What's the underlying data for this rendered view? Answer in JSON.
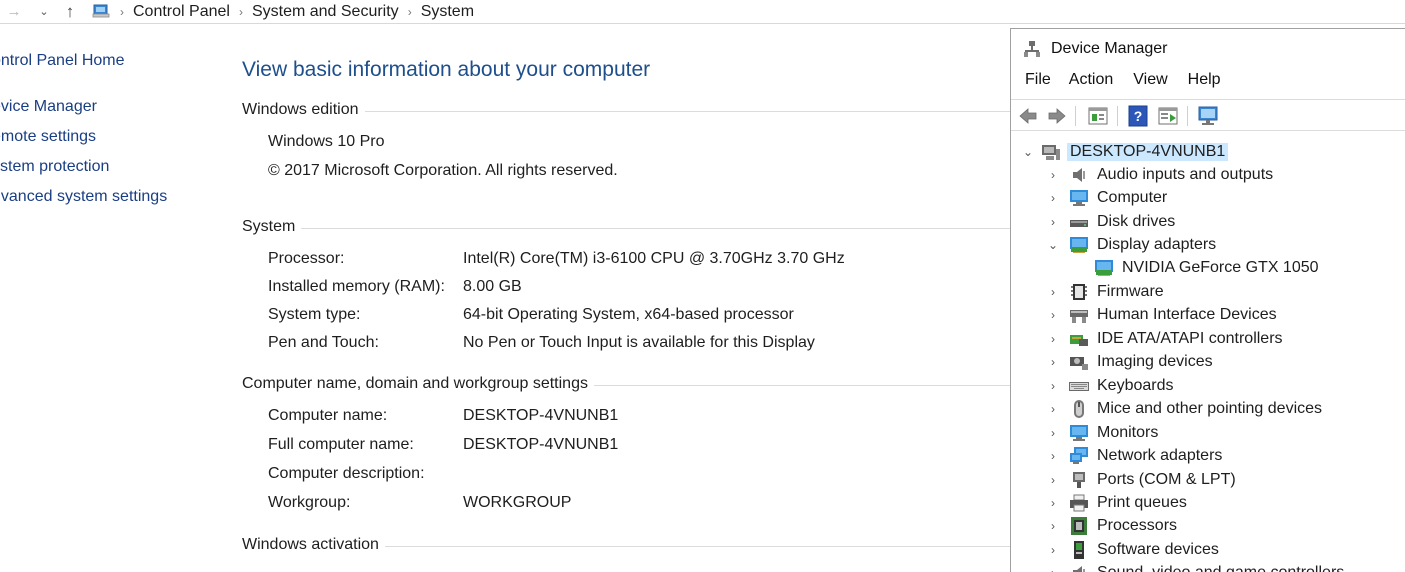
{
  "breadcrumb": {
    "items": [
      "Control Panel",
      "System and Security",
      "System"
    ],
    "separator": "›"
  },
  "left_nav": {
    "home": "ontrol Panel Home",
    "items": [
      "evice Manager",
      "emote settings",
      "ystem protection",
      "dvanced system settings"
    ]
  },
  "main": {
    "title": "View basic information about your computer",
    "edition": {
      "heading": "Windows edition",
      "name": "Windows 10 Pro",
      "copyright": "© 2017 Microsoft Corporation. All rights reserved."
    },
    "system": {
      "heading": "System",
      "rows": [
        {
          "k": "Processor:",
          "v": "Intel(R) Core(TM) i3-6100 CPU @ 3.70GHz   3.70 GHz"
        },
        {
          "k": "Installed memory (RAM):",
          "v": "8.00 GB"
        },
        {
          "k": "System type:",
          "v": "64-bit Operating System, x64-based processor"
        },
        {
          "k": "Pen and Touch:",
          "v": "No Pen or Touch Input is available for this Display"
        }
      ]
    },
    "computer": {
      "heading": "Computer name, domain and workgroup settings",
      "rows": [
        {
          "k": "Computer name:",
          "v": "DESKTOP-4VNUNB1"
        },
        {
          "k": "Full computer name:",
          "v": "DESKTOP-4VNUNB1"
        },
        {
          "k": "Computer description:",
          "v": ""
        },
        {
          "k": "Workgroup:",
          "v": "WORKGROUP"
        }
      ]
    },
    "activation": {
      "heading": "Windows activation"
    }
  },
  "device_manager": {
    "title": "Device Manager",
    "menu": [
      "File",
      "Action",
      "View",
      "Help"
    ],
    "root": "DESKTOP-4VNUNB1",
    "nodes": [
      {
        "label": "Audio inputs and outputs",
        "icon": "speaker-icon",
        "expanded": false
      },
      {
        "label": "Computer",
        "icon": "monitor-icon",
        "expanded": false
      },
      {
        "label": "Disk drives",
        "icon": "disk-drive-icon",
        "expanded": false
      },
      {
        "label": "Display adapters",
        "icon": "display-adapter-icon",
        "expanded": true
      },
      {
        "label": "NVIDIA GeForce GTX 1050",
        "icon": "display-adapter-icon",
        "child": true
      },
      {
        "label": "Firmware",
        "icon": "chip-icon",
        "expanded": false
      },
      {
        "label": "Human Interface Devices",
        "icon": "hid-icon",
        "expanded": false
      },
      {
        "label": "IDE ATA/ATAPI controllers",
        "icon": "controller-icon",
        "expanded": false
      },
      {
        "label": "Imaging devices",
        "icon": "camera-icon",
        "expanded": false
      },
      {
        "label": "Keyboards",
        "icon": "keyboard-icon",
        "expanded": false
      },
      {
        "label": "Mice and other pointing devices",
        "icon": "mouse-icon",
        "expanded": false
      },
      {
        "label": "Monitors",
        "icon": "monitor-icon",
        "expanded": false
      },
      {
        "label": "Network adapters",
        "icon": "network-icon",
        "expanded": false
      },
      {
        "label": "Ports (COM & LPT)",
        "icon": "port-icon",
        "expanded": false
      },
      {
        "label": "Print queues",
        "icon": "printer-icon",
        "expanded": false
      },
      {
        "label": "Processors",
        "icon": "processor-icon",
        "expanded": false
      },
      {
        "label": "Software devices",
        "icon": "software-device-icon",
        "expanded": false
      },
      {
        "label": "Sound, video and game controllers",
        "icon": "speaker-icon",
        "expanded": false
      }
    ]
  },
  "colors": {
    "link": "#1a3e84",
    "title": "#1e4f8c",
    "selection": "#cce8ff"
  }
}
